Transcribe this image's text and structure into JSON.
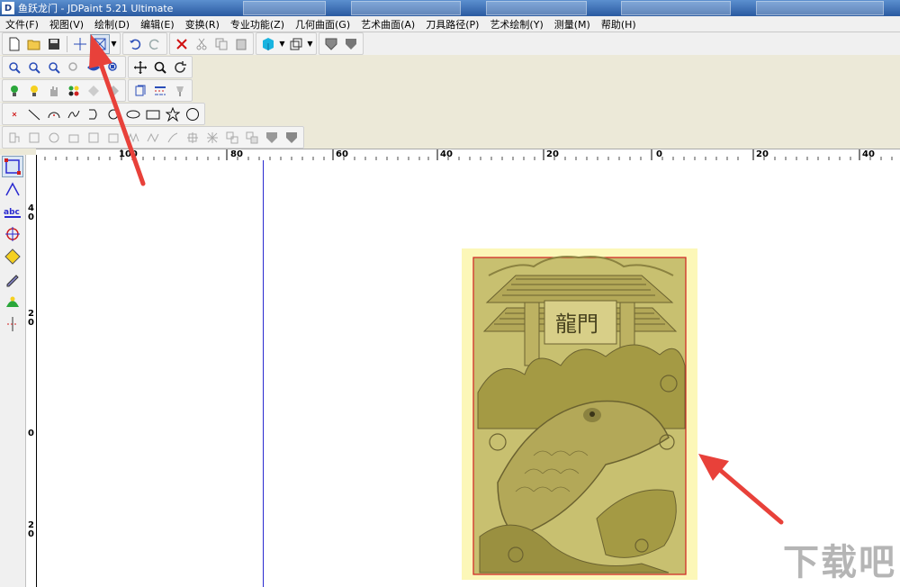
{
  "window": {
    "title": "鱼跃龙门 - JDPaint 5.21 Ultimate",
    "app_icon": "jdpaint-app-icon"
  },
  "menu": {
    "items": [
      {
        "label": "文件(F)"
      },
      {
        "label": "视图(V)"
      },
      {
        "label": "绘制(D)"
      },
      {
        "label": "编辑(E)"
      },
      {
        "label": "变换(R)"
      },
      {
        "label": "专业功能(Z)"
      },
      {
        "label": "几何曲面(G)"
      },
      {
        "label": "艺术曲面(A)"
      },
      {
        "label": "刀具路径(P)"
      },
      {
        "label": "艺术绘制(Y)"
      },
      {
        "label": "测量(M)"
      },
      {
        "label": "帮助(H)"
      }
    ]
  },
  "ruler": {
    "horizontal": [
      "100",
      "80",
      "60",
      "40",
      "20",
      "0",
      "20",
      "40"
    ],
    "vertical": [
      "4\n0",
      "2\n0",
      "0",
      "2\n0"
    ]
  },
  "canvas": {
    "relief_inscription": "龍門",
    "accent": "#2a2ad0",
    "relief_bg": "#fcf7b8",
    "relief_gold": "#a49a44",
    "border_red": "#d02020"
  },
  "annotations": {
    "arrow_color": "#e8413a"
  },
  "watermark": {
    "text": "下载吧"
  }
}
